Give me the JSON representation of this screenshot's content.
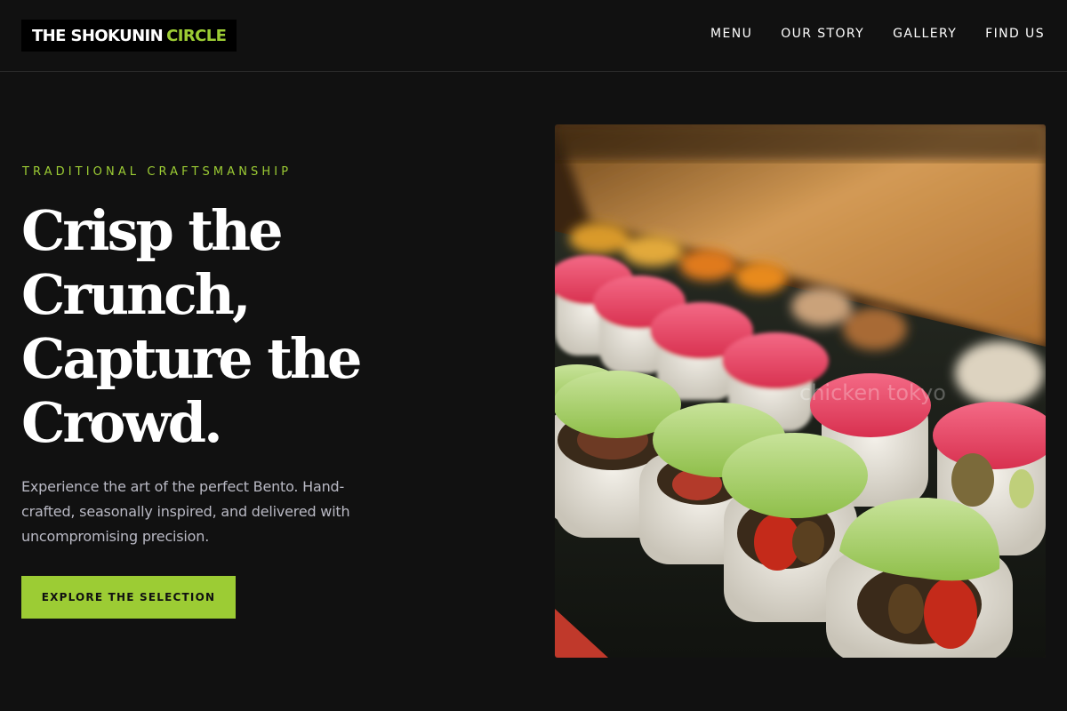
{
  "header": {
    "logo_primary": "THE SHOKUNIN",
    "logo_accent": "CIRCLE",
    "nav": [
      "MENU",
      "OUR STORY",
      "GALLERY",
      "FIND US"
    ]
  },
  "hero": {
    "eyebrow": "TRADITIONAL CRAFTSMANSHIP",
    "headline_lines": [
      "Crisp the",
      "Crunch,",
      "Capture the",
      "Crowd."
    ],
    "subtext_lines": [
      "Experience the art of the perfect Bento. Hand-",
      "crafted, seasonally inspired, and delivered with",
      "uncompromising precision."
    ],
    "cta_label": "EXPLORE THE SELECTION",
    "image_watermark": "chicken tokyo"
  },
  "colors": {
    "background": "#111111",
    "accent": "#9ccc34",
    "body_text": "#b9b9c4"
  }
}
